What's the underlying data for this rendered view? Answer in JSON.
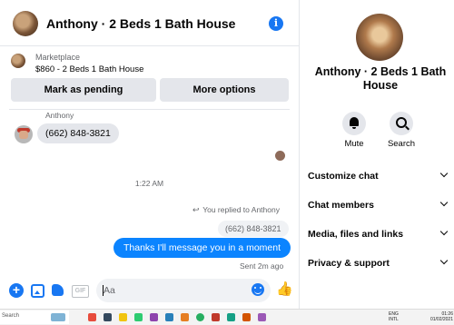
{
  "header": {
    "title": "Anthony · 2 Beds 1 Bath House",
    "info_glyph": "i"
  },
  "marketplace": {
    "label": "Marketplace",
    "item": "$860 - 2 Beds 1 Bath House",
    "buttons": {
      "pending": "Mark as pending",
      "more": "More options"
    }
  },
  "messages": {
    "sender_name": "Anthony",
    "incoming_text": "(662) 848-3821",
    "timestamp": "1:22 AM",
    "replied_note": "You replied to Anthony",
    "quoted_text": "(662) 848-3821",
    "outgoing_text": "Thanks I'll message you in a moment",
    "sent_status": "Sent 2m ago"
  },
  "composer": {
    "placeholder": "Aa",
    "gif_label": "GIF",
    "plus_glyph": "+",
    "like_glyph": "👍"
  },
  "side_panel": {
    "name": "Anthony · 2 Beds 1 Bath House",
    "actions": {
      "mute": "Mute",
      "search": "Search"
    },
    "menu": [
      {
        "label": "Customize chat"
      },
      {
        "label": "Chat members"
      },
      {
        "label": "Media, files and links"
      },
      {
        "label": "Privacy & support"
      }
    ]
  },
  "taskbar": {
    "search_label": "Search",
    "tray_lang_1": "ENG",
    "tray_lang_2": "INTL",
    "time": "01:26",
    "date": "01/02/2021"
  },
  "colors": {
    "accent": "#1877f2",
    "outgoing_bubble": "#0b84ff",
    "incoming_bubble": "#e4e6eb",
    "secondary_text": "#65676b"
  },
  "icons": [
    "info-icon",
    "plus-icon",
    "photo-icon",
    "sticker-icon",
    "gif-icon",
    "emoji-icon",
    "like-icon",
    "bell-icon",
    "search-icon",
    "chevron-down-icon",
    "reply-icon"
  ]
}
